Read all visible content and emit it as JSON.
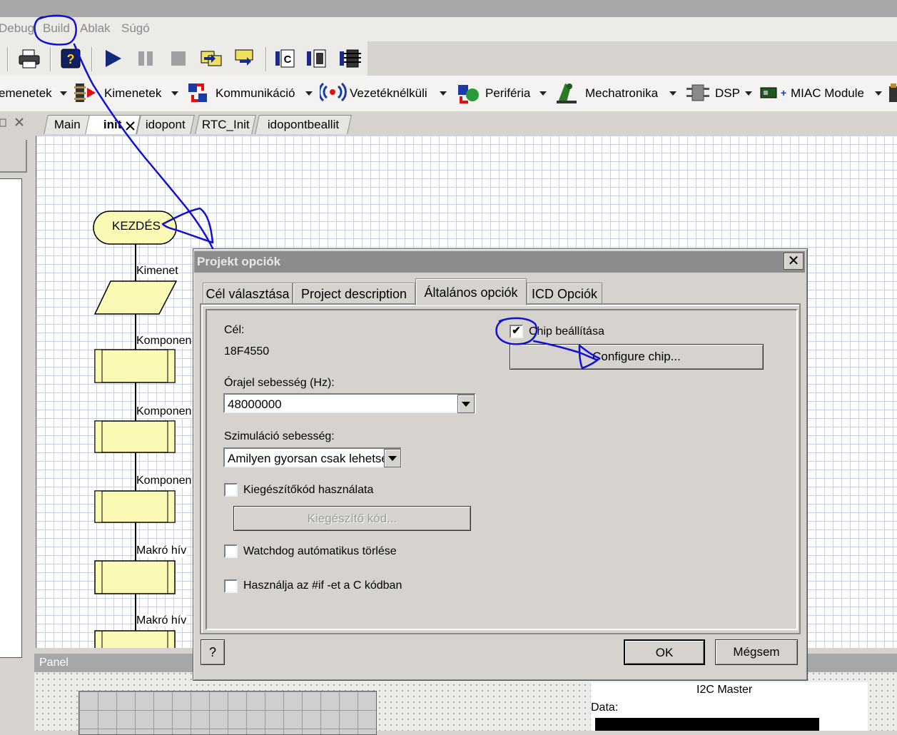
{
  "menu": {
    "items": [
      "Debug",
      "Build",
      "Ablak",
      "Súgó"
    ]
  },
  "toolbar": {
    "icons": [
      "print-icon",
      "compile-icon",
      "run-icon",
      "pause-icon",
      "stop-icon",
      "step-into-icon",
      "step-over-icon",
      "icon-c",
      "icon-chip",
      "icon-chip-2"
    ]
  },
  "components": {
    "items": [
      {
        "label": "emenetek",
        "icon": "inputs-icon"
      },
      {
        "label": "Kimenetek",
        "icon": "outputs-icon"
      },
      {
        "label": "Kommunikáció",
        "icon": "communication-icon"
      },
      {
        "label": "Vezetéknélküli",
        "icon": "wireless-icon"
      },
      {
        "label": "Periféria",
        "icon": "peripheral-icon"
      },
      {
        "label": "Mechatronika",
        "icon": "mechatronics-icon"
      },
      {
        "label": "DSP",
        "icon": "dsp-icon"
      },
      {
        "label": "MIAC Module",
        "icon": "miac-icon"
      }
    ]
  },
  "tabs": [
    "Main",
    "init",
    "idopont",
    "RTC_Init",
    "idopontbeallit"
  ],
  "flowchart": {
    "start_label": "KEZDÉS",
    "labels": [
      "Kimenet",
      "Komponen",
      "Komponen",
      "Komponen",
      "Makró hív",
      "Makró hív"
    ]
  },
  "panel": {
    "title": "Panel",
    "i2c_title": "I2C Master",
    "i2c_data_label": "Data:"
  },
  "dialog": {
    "title": "Projekt opciók",
    "tabs": [
      "Cél választása",
      "Project description",
      "Általános opciók",
      "ICD Opciók"
    ],
    "active_tab": "Általános opciók",
    "target_label": "Cél:",
    "target_value": "18F4550",
    "clock_label": "Órajel sebesség (Hz):",
    "clock_value": "48000000",
    "sim_label": "Szimuláció sebesség:",
    "sim_value": "Amilyen gyorsan csak lehetség",
    "supp_code_label": "Kiegészítőkód használata",
    "supp_code_checked": false,
    "supp_code_button": "Kiegészítő kód...",
    "watchdog_label": "Watchdog autómatikus törlése",
    "watchdog_checked": false,
    "ifdef_label": "Használja az #if -et a C kódban",
    "ifdef_checked": false,
    "chip_config_label": "Chip beállítása",
    "chip_config_checked": true,
    "configure_chip_button": "Configure chip...",
    "help_button": "?",
    "ok_button": "OK",
    "cancel_button": "Mégsem",
    "close_glyph": "✕",
    "check_glyph": "✔"
  },
  "colors": {
    "annotation": "#1010d0",
    "flow_fill": "#fafab4",
    "title_bar": "#8c8c8c"
  }
}
